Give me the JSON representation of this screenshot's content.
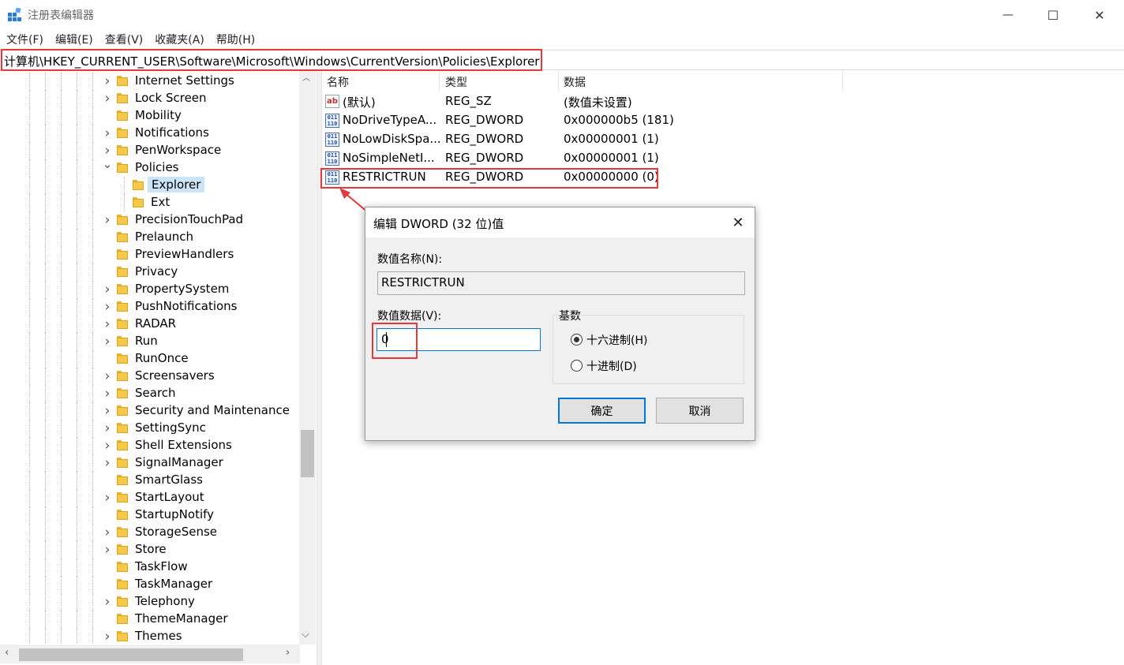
{
  "window": {
    "title": "注册表编辑器",
    "minimize_glyph": "—",
    "maximize_glyph": "☐",
    "close_glyph": "✕"
  },
  "menu": [
    "文件(F)",
    "编辑(E)",
    "查看(V)",
    "收藏夹(A)",
    "帮助(H)"
  ],
  "address": "计算机\\HKEY_CURRENT_USER\\Software\\Microsoft\\Windows\\CurrentVersion\\Policies\\Explorer",
  "tree": [
    {
      "label": "Internet Settings",
      "expandable": true
    },
    {
      "label": "Lock Screen",
      "expandable": true
    },
    {
      "label": "Mobility",
      "expandable": false
    },
    {
      "label": "Notifications",
      "expandable": true
    },
    {
      "label": "PenWorkspace",
      "expandable": true
    },
    {
      "label": "Policies",
      "expandable": true,
      "expanded": true
    },
    {
      "label": "Explorer",
      "level": 2,
      "selected": true
    },
    {
      "label": "Ext",
      "level": 2
    },
    {
      "label": "PrecisionTouchPad",
      "expandable": true
    },
    {
      "label": "Prelaunch",
      "expandable": false
    },
    {
      "label": "PreviewHandlers",
      "expandable": false
    },
    {
      "label": "Privacy",
      "expandable": false
    },
    {
      "label": "PropertySystem",
      "expandable": true
    },
    {
      "label": "PushNotifications",
      "expandable": true
    },
    {
      "label": "RADAR",
      "expandable": true
    },
    {
      "label": "Run",
      "expandable": true
    },
    {
      "label": "RunOnce",
      "expandable": false
    },
    {
      "label": "Screensavers",
      "expandable": true
    },
    {
      "label": "Search",
      "expandable": true
    },
    {
      "label": "Security and Maintenance",
      "expandable": true
    },
    {
      "label": "SettingSync",
      "expandable": true
    },
    {
      "label": "Shell Extensions",
      "expandable": true
    },
    {
      "label": "SignalManager",
      "expandable": true
    },
    {
      "label": "SmartGlass",
      "expandable": false
    },
    {
      "label": "StartLayout",
      "expandable": true
    },
    {
      "label": "StartupNotify",
      "expandable": false
    },
    {
      "label": "StorageSense",
      "expandable": true
    },
    {
      "label": "Store",
      "expandable": true
    },
    {
      "label": "TaskFlow",
      "expandable": false
    },
    {
      "label": "TaskManager",
      "expandable": false
    },
    {
      "label": "Telephony",
      "expandable": true
    },
    {
      "label": "ThemeManager",
      "expandable": false
    },
    {
      "label": "Themes",
      "expandable": true
    }
  ],
  "list": {
    "headers": {
      "name": "名称",
      "type": "类型",
      "data": "数据"
    },
    "rows": [
      {
        "icon": "string-value-icon",
        "name": "(默认)",
        "type": "REG_SZ",
        "data": "(数值未设置)"
      },
      {
        "icon": "binary-value-icon",
        "name": "NoDriveTypeA...",
        "type": "REG_DWORD",
        "data": "0x000000b5 (181)"
      },
      {
        "icon": "binary-value-icon",
        "name": "NoLowDiskSpa...",
        "type": "REG_DWORD",
        "data": "0x00000001 (1)"
      },
      {
        "icon": "binary-value-icon",
        "name": "NoSimpleNetI...",
        "type": "REG_DWORD",
        "data": "0x00000001 (1)"
      },
      {
        "icon": "binary-value-icon",
        "name": "RESTRICTRUN",
        "type": "REG_DWORD",
        "data": "0x00000000 (0)"
      }
    ]
  },
  "dialog": {
    "title": "编辑 DWORD (32 位)值",
    "name_label": "数值名称(N):",
    "name_value": "RESTRICTRUN",
    "data_label": "数值数据(V):",
    "data_value": "0",
    "base_label": "基数",
    "radio_hex": "十六进制(H)",
    "radio_dec": "十进制(D)",
    "selected_base": "hex",
    "ok": "确定",
    "cancel": "取消"
  },
  "colors": {
    "highlight_box": "#e5383b",
    "selection": "#cce4f7",
    "focus": "#0078d7"
  }
}
